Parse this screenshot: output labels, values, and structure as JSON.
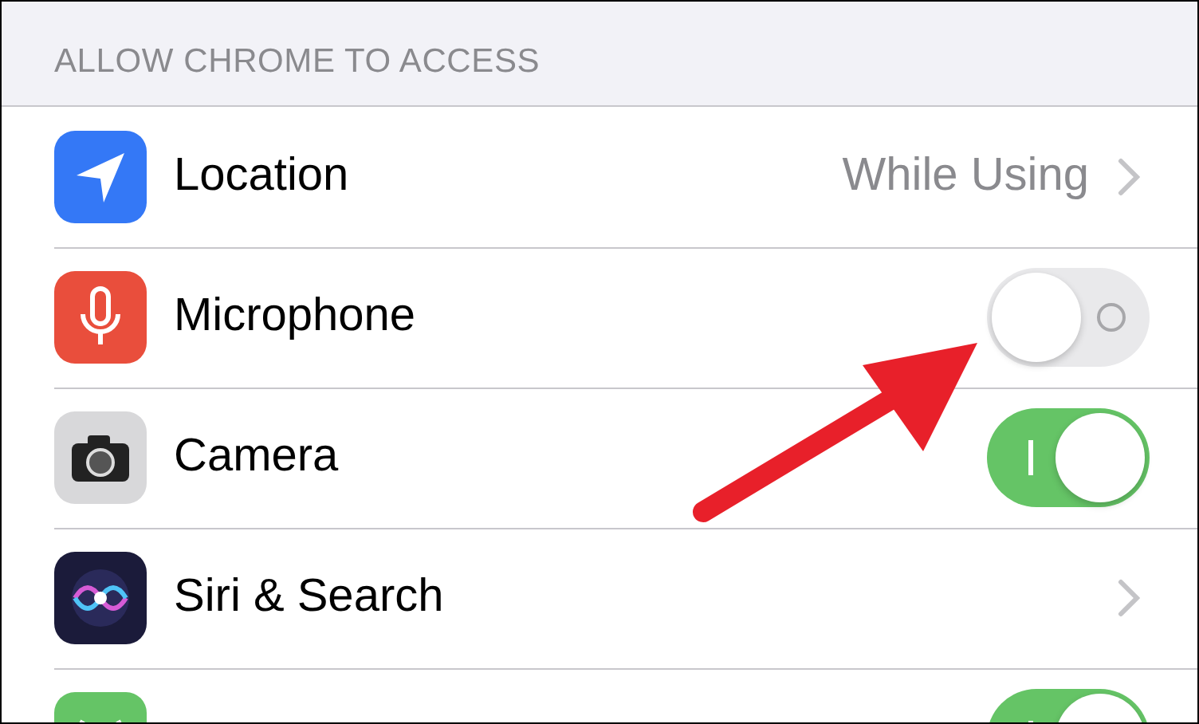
{
  "section_header": "ALLOW CHROME TO ACCESS",
  "rows": [
    {
      "kind": "link",
      "label": "Location",
      "value": "While Using"
    },
    {
      "kind": "toggle",
      "label": "Microphone",
      "on": false
    },
    {
      "kind": "toggle",
      "label": "Camera",
      "on": true
    },
    {
      "kind": "link",
      "label": "Siri & Search"
    },
    {
      "kind": "toggle",
      "on": true
    }
  ]
}
